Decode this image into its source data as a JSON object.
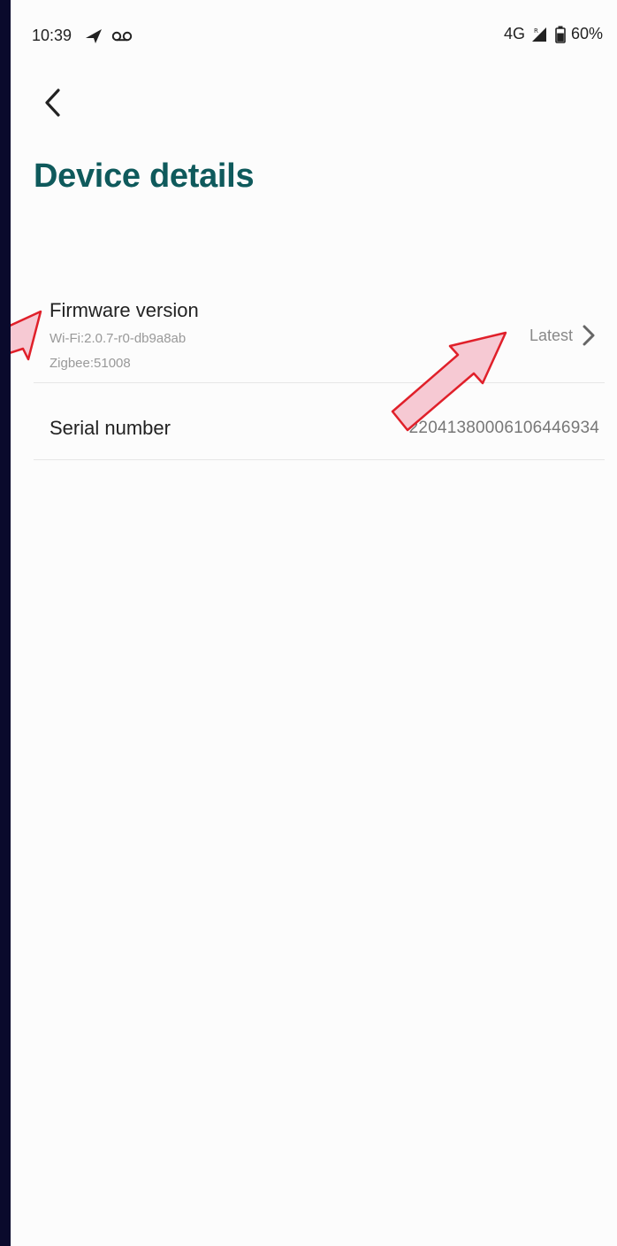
{
  "status_bar": {
    "time": "10:39",
    "network": "4G",
    "battery": "60%",
    "icons": [
      "navigation-arrow-icon",
      "voicemail-icon",
      "signal-icon",
      "battery-icon"
    ]
  },
  "header": {
    "title": "Device details",
    "back_icon": "chevron-left-icon"
  },
  "rows": {
    "firmware": {
      "label": "Firmware version",
      "wifi": "Wi-Fi:2.0.7-r0-db9a8ab",
      "zigbee": "Zigbee:51008",
      "status": "Latest",
      "chevron_icon": "chevron-right-icon"
    },
    "serial": {
      "label": "Serial number",
      "value": "22041380006106446934"
    }
  },
  "annotation_color": "#e0202a",
  "annotation_fill": "#f6c9d3"
}
